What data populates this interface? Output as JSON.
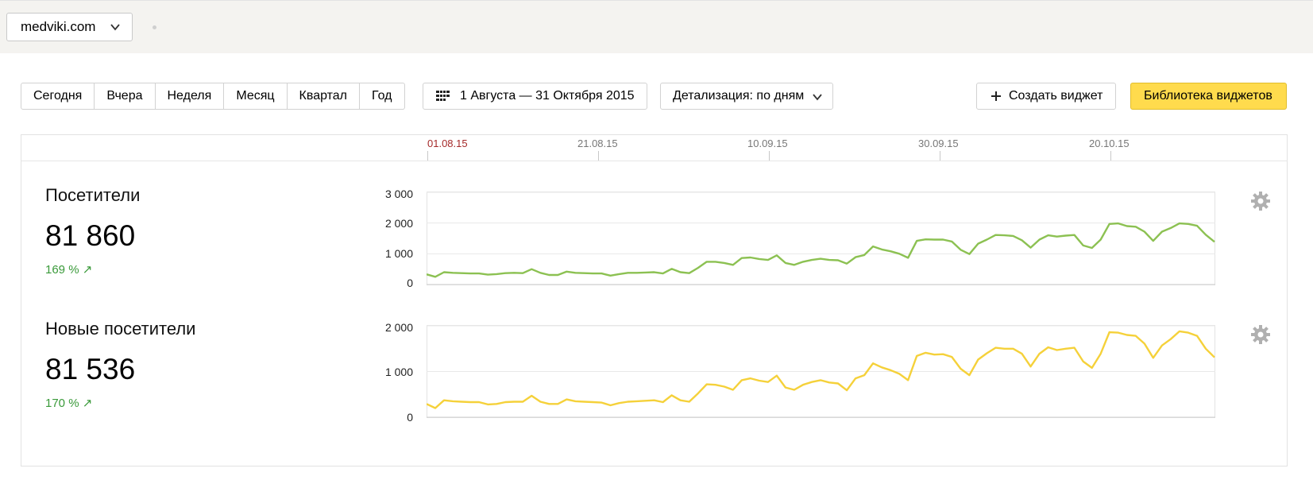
{
  "header": {
    "site": "medviki.com"
  },
  "toolbar": {
    "periods": [
      "Сегодня",
      "Вчера",
      "Неделя",
      "Месяц",
      "Квартал",
      "Год"
    ],
    "date_range": "1 Августа — 31 Октября 2015",
    "detail": "Детализация: по дням",
    "create_widget": "Создать виджет",
    "widget_library": "Библиотека виджетов"
  },
  "timeline": {
    "dates": [
      "01.08.15",
      "21.08.15",
      "10.09.15",
      "30.09.15",
      "20.10.15"
    ]
  },
  "metrics": [
    {
      "title": "Посетители",
      "value": "81 860",
      "growth": "169 % ↗",
      "color": "#8cc152"
    },
    {
      "title": "Новые посетители",
      "value": "81 536",
      "growth": "170 % ↗",
      "color": "#f5d13a"
    }
  ],
  "chart_data": [
    {
      "type": "line",
      "series": [
        {
          "values": [
            330,
            250,
            400,
            380,
            370,
            360,
            360,
            320,
            340,
            370,
            380,
            370,
            500,
            380,
            310,
            310,
            420,
            380,
            370,
            360,
            360,
            290,
            340,
            380,
            380,
            390,
            400,
            360,
            510,
            400,
            370,
            540,
            740,
            740,
            700,
            640,
            860,
            880,
            830,
            800,
            950,
            700,
            640,
            740,
            800,
            840,
            800,
            790,
            680,
            890,
            960,
            1240,
            1140,
            1080,
            1000,
            870,
            1420,
            1470,
            1460,
            1460,
            1400,
            1130,
            990,
            1330,
            1460,
            1610,
            1600,
            1580,
            1440,
            1200,
            1460,
            1600,
            1560,
            1590,
            1610,
            1270,
            1190,
            1460,
            1970,
            1990,
            1900,
            1880,
            1720,
            1420,
            1720,
            1840,
            1990,
            1970,
            1910,
            1620,
            1390
          ]
        }
      ],
      "x_start": "01.08.15",
      "x_end": "31.10.15",
      "y_ticks": [
        0,
        1000,
        2000,
        3000
      ],
      "y_tick_labels": [
        "0",
        "1 000",
        "2 000",
        "3 000"
      ],
      "ylim": [
        0,
        3000
      ],
      "grid": true
    },
    {
      "type": "line",
      "series": [
        {
          "values": [
            290,
            200,
            370,
            350,
            340,
            330,
            330,
            280,
            290,
            330,
            340,
            340,
            470,
            340,
            290,
            290,
            390,
            350,
            340,
            330,
            320,
            260,
            310,
            340,
            350,
            360,
            370,
            330,
            480,
            370,
            340,
            520,
            720,
            710,
            670,
            600,
            810,
            850,
            800,
            770,
            910,
            650,
            600,
            710,
            770,
            810,
            760,
            740,
            590,
            850,
            920,
            1180,
            1090,
            1030,
            950,
            810,
            1340,
            1410,
            1370,
            1380,
            1320,
            1060,
            920,
            1260,
            1400,
            1520,
            1500,
            1500,
            1390,
            1110,
            1390,
            1530,
            1470,
            1500,
            1520,
            1220,
            1080,
            1390,
            1860,
            1850,
            1800,
            1780,
            1610,
            1300,
            1570,
            1710,
            1880,
            1850,
            1780,
            1500,
            1310
          ]
        }
      ],
      "x_start": "01.08.15",
      "x_end": "31.10.15",
      "y_ticks": [
        0,
        1000,
        2000
      ],
      "y_tick_labels": [
        "0",
        "1 000",
        "2 000"
      ],
      "ylim": [
        0,
        2000
      ],
      "grid": true
    }
  ]
}
